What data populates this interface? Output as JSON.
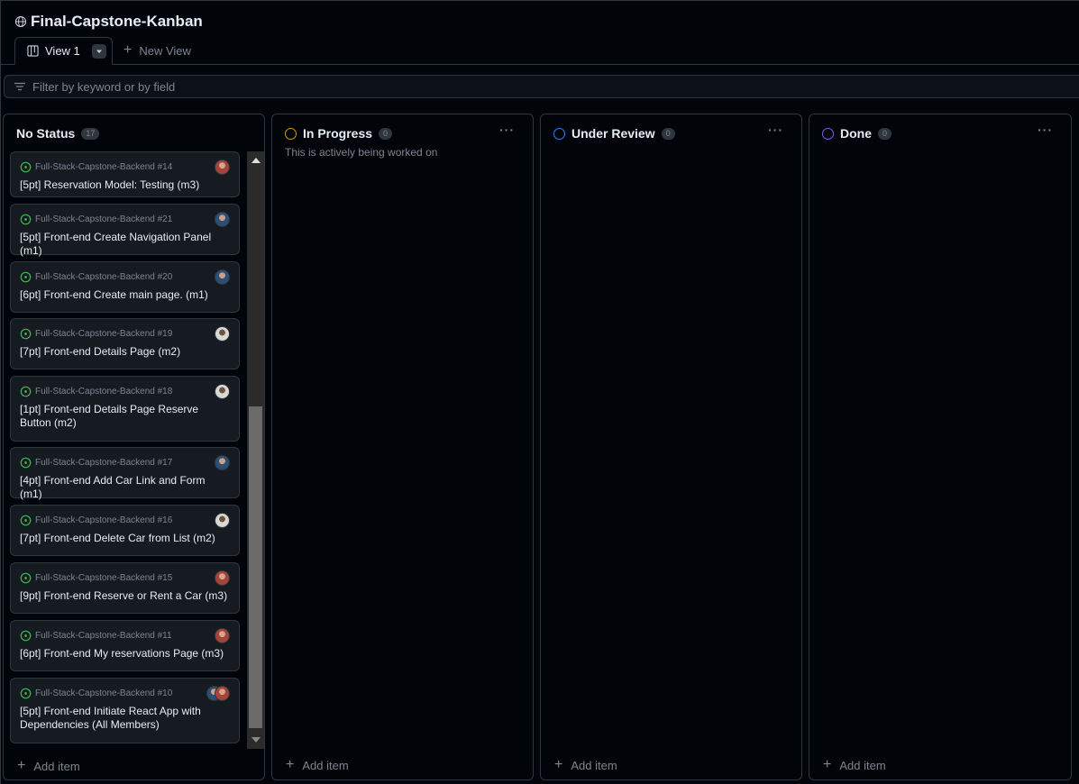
{
  "project": {
    "title": "Final-Capstone-Kanban"
  },
  "tabs": {
    "view_label": "View 1",
    "new_view_label": "New View"
  },
  "filter": {
    "placeholder": "Filter by keyword or by field"
  },
  "colors": {
    "in_progress": "#d29922",
    "under_review": "#2f81f7",
    "done": "#8957e5",
    "issue_open": "#3fb950"
  },
  "columns": [
    {
      "title": "No Status",
      "count": "17",
      "add_item_label": "Add item",
      "cards": [
        {
          "repo": "Full-Stack-Capstone-Backend #14",
          "title": "[5pt] Reservation Model: Testing (m3)"
        },
        {
          "repo": "Full-Stack-Capstone-Backend #21",
          "title": "[5pt] Front-end Create Navigation Panel (m1)"
        },
        {
          "repo": "Full-Stack-Capstone-Backend #20",
          "title": "[6pt] Front-end Create main page. (m1)"
        },
        {
          "repo": "Full-Stack-Capstone-Backend #19",
          "title": "[7pt] Front-end Details Page (m2)"
        },
        {
          "repo": "Full-Stack-Capstone-Backend #18",
          "title": "[1pt] Front-end Details Page Reserve Button (m2)"
        },
        {
          "repo": "Full-Stack-Capstone-Backend #17",
          "title": "[4pt] Front-end Add Car Link and Form (m1)"
        },
        {
          "repo": "Full-Stack-Capstone-Backend #16",
          "title": "[7pt] Front-end Delete Car from List (m2)"
        },
        {
          "repo": "Full-Stack-Capstone-Backend #15",
          "title": "[9pt] Front-end Reserve or Rent a Car (m3)"
        },
        {
          "repo": "Full-Stack-Capstone-Backend #11",
          "title": "[6pt] Front-end My reservations Page (m3)"
        },
        {
          "repo": "Full-Stack-Capstone-Backend #10",
          "title": "[5pt] Front-end Initiate React App with Dependencies (All Members)"
        }
      ]
    },
    {
      "title": "In Progress",
      "count": "0",
      "description": "This is actively being worked on",
      "add_item_label": "Add item"
    },
    {
      "title": "Under Review",
      "count": "0",
      "add_item_label": "Add item"
    },
    {
      "title": "Done",
      "count": "0",
      "add_item_label": "Add item"
    }
  ]
}
